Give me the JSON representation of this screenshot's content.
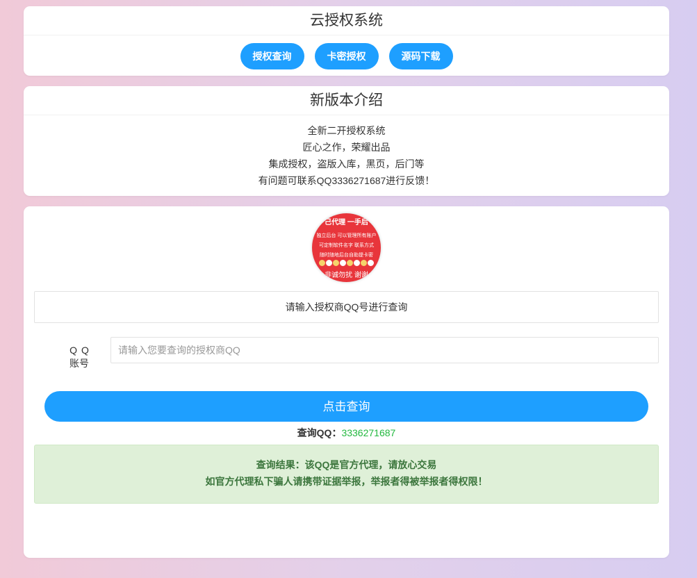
{
  "system": {
    "title": "云授权系统",
    "buttons": [
      "授权查询",
      "卡密授权",
      "源码下载"
    ]
  },
  "intro": {
    "title": "新版本介绍",
    "lines": [
      "全新二开授权系统",
      "匠心之作，荣耀出品",
      "集成授权，盗版入库，黑页，后门等",
      "有问题可联系QQ3336271687进行反馈！"
    ]
  },
  "avatar": {
    "lines": [
      "己代理 一手后",
      "独立后台 可以管理所有账户",
      "可定制软件名字 联系方式",
      "随时随地后台自助提卡密",
      "非诚勿扰 谢谢"
    ]
  },
  "query": {
    "hint": "请输入授权商QQ号进行查询",
    "label_line1": "QQ",
    "label_line2": "账号",
    "placeholder": "请输入您要查询的授权商QQ",
    "submit_label": "点击查询",
    "qq_label": "查询QQ：",
    "qq_value": "3336271687"
  },
  "result": {
    "line1": "查询结果：该QQ是官方代理，请放心交易",
    "line2": "如官方代理私下骗人请携带证据举报，举报者得被举报者得权限！"
  },
  "colors": {
    "accent": "#1e9fff",
    "success_text": "#3c763d",
    "success_bg": "#dff0d8",
    "qq_value": "#22b83e"
  }
}
